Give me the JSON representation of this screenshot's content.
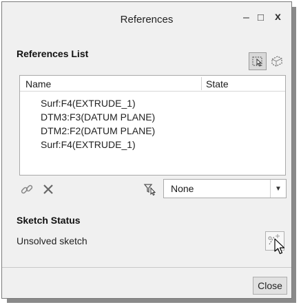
{
  "window": {
    "title": "References",
    "minimize_glyph": "–",
    "maximize_glyph": "□",
    "close_glyph": "x"
  },
  "references": {
    "label": "References List",
    "columns": {
      "name": "Name",
      "state": "State"
    },
    "items": [
      "Surf:F4(EXTRUDE_1)",
      "DTM3:F3(DATUM PLANE)",
      "DTM2:F2(DATUM PLANE)",
      "Surf:F4(EXTRUDE_1)"
    ]
  },
  "filter": {
    "selected": "None"
  },
  "sketch_status": {
    "label": "Sketch Status",
    "text": "Unsolved sketch"
  },
  "footer": {
    "close_label": "Close"
  },
  "icons": {
    "select_references_tool": "select-references-icon",
    "select_geometry_tool": "select-geometry-icon",
    "link_references": "chain-link-icon",
    "delete_reference": "delete-x-icon",
    "filter": "filter-cursor-icon",
    "solve_sketch": "solve-sketch-icon",
    "mouse_cursor": "mouse-pointer-icon"
  },
  "colors": {
    "dialog_bg": "#f0f0f0",
    "list_bg": "#ffffff",
    "border": "#a9a9a9"
  }
}
